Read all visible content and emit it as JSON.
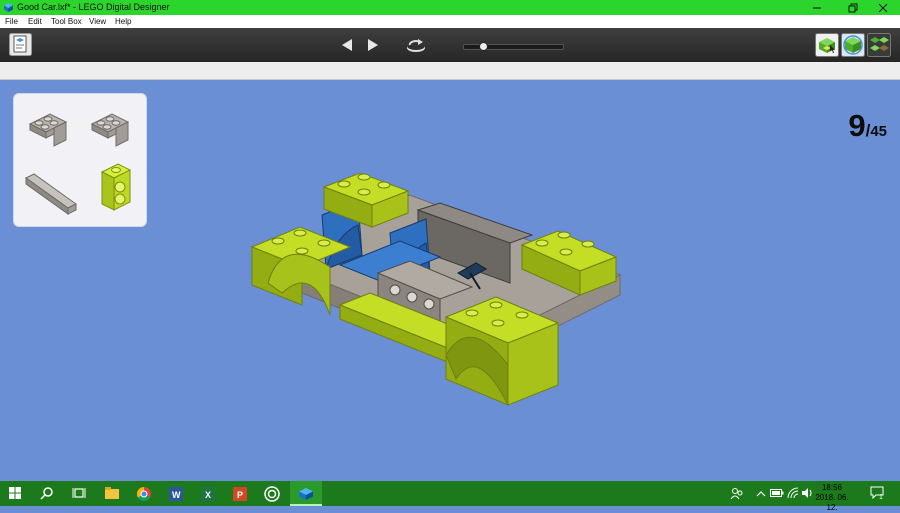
{
  "window": {
    "title": "Good Car.lxf* - LEGO Digital Designer",
    "app_icon": "lego-brick-icon"
  },
  "menu": {
    "items": [
      "File",
      "Edit",
      "Tool Box",
      "View",
      "Help"
    ]
  },
  "toolbar": {
    "icons": [
      "building-guide-icon",
      "previous-step-icon",
      "next-step-icon",
      "rotate-view-icon",
      "build-mode-icon",
      "view-mode-icon",
      "guide-mode-icon"
    ],
    "step_progress": 0.2
  },
  "step_counter": {
    "current": "9",
    "separator": "/",
    "total": "45"
  },
  "parts_panel": {
    "parts": [
      "angle-plate-2x2-gray",
      "angle-plate-2x2-gray",
      "tile-1x4-gray",
      "plate-1x2-lime"
    ]
  },
  "taskbar": {
    "apps": [
      "start-icon",
      "search-icon",
      "task-view-icon",
      "file-explorer-icon",
      "chrome-icon",
      "word-icon",
      "excel-icon",
      "powerpoint-icon",
      "target-app-icon",
      "lego-designer-icon"
    ],
    "clock": {
      "time": "18:56",
      "date": "2018. 06. 12."
    },
    "notification_count": "1"
  },
  "colors": {
    "titlebar": "#2bd52b",
    "taskbar": "#1c7a1c",
    "viewport": "#6b8fd5",
    "brick_lime": "#b3d21e",
    "brick_gray": "#a6a09a",
    "brick_blue": "#2f6fc0"
  }
}
